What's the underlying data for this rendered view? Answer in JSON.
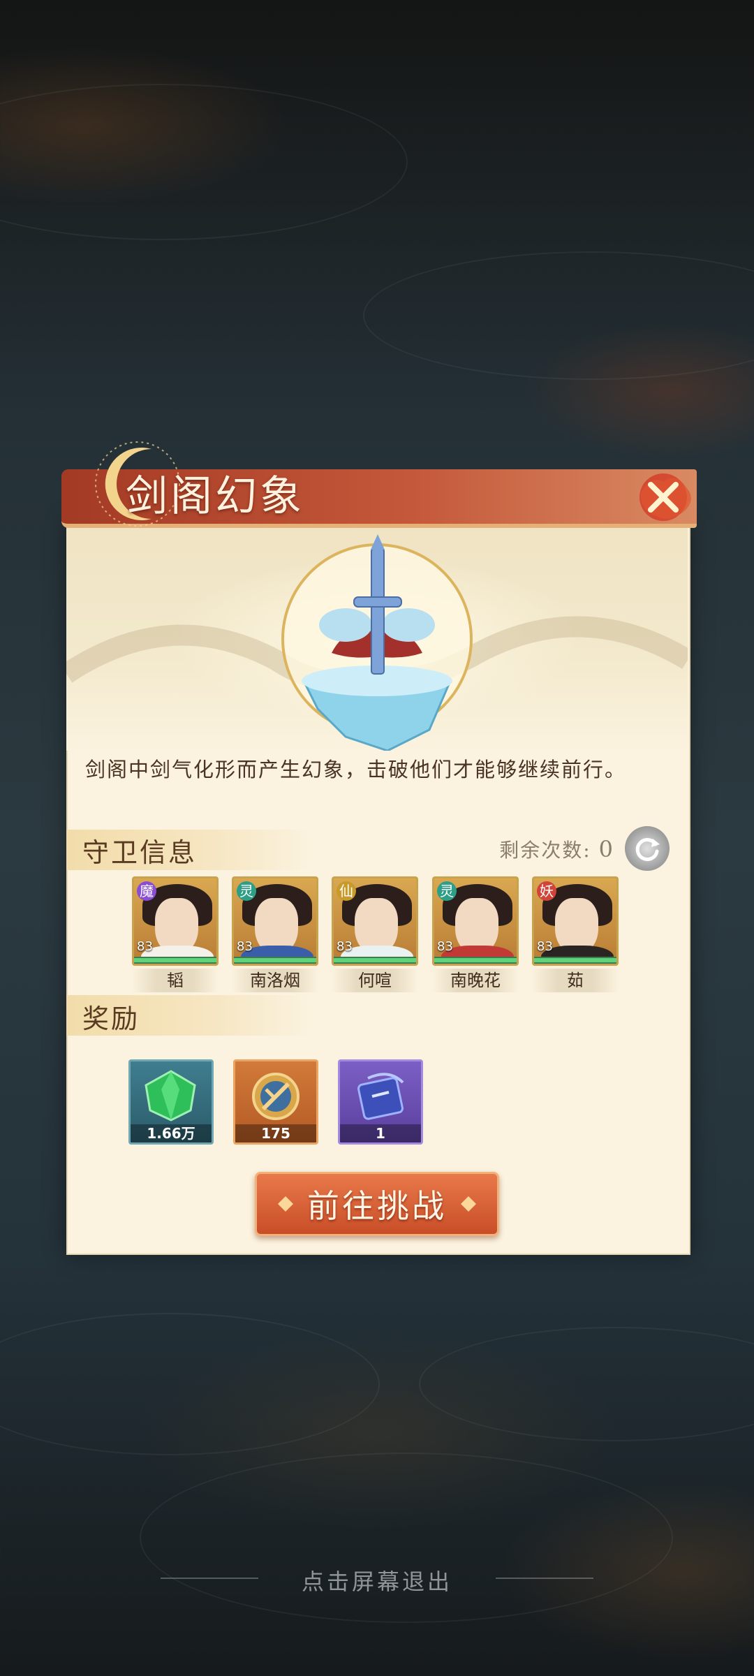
{
  "dialog": {
    "title": "剑阁幻象",
    "description": "剑阁中剑气化形而产生幻象，击破他们才能够继续前行。"
  },
  "guards_section": {
    "title": "守卫信息",
    "remaining_label": "剩余次数:",
    "remaining_value": "0",
    "guards": [
      {
        "name": "韬",
        "level": "83",
        "faction": "魔",
        "faction_color": "#8a4fd1"
      },
      {
        "name": "南洛烟",
        "level": "83",
        "faction": "灵",
        "faction_color": "#2e9f86"
      },
      {
        "name": "何喧",
        "level": "83",
        "faction": "仙",
        "faction_color": "#c79a2a"
      },
      {
        "name": "南晚花",
        "level": "83",
        "faction": "灵",
        "faction_color": "#2e9f86"
      },
      {
        "name": "茹",
        "level": "83",
        "faction": "妖",
        "faction_color": "#d0443a"
      }
    ]
  },
  "rewards_section": {
    "title": "奖励",
    "items": [
      {
        "icon": "green-jade-icon",
        "count": "1.66万"
      },
      {
        "icon": "sword-coin-icon",
        "count": "175"
      },
      {
        "icon": "purple-scroll-icon",
        "count": "1"
      }
    ]
  },
  "actions": {
    "challenge_label": "前往挑战"
  },
  "footer": {
    "exit_hint": "点击屏幕退出"
  },
  "colors": {
    "banner": "#c4583a",
    "panel": "#fbf3df",
    "button": "#d85f33"
  }
}
